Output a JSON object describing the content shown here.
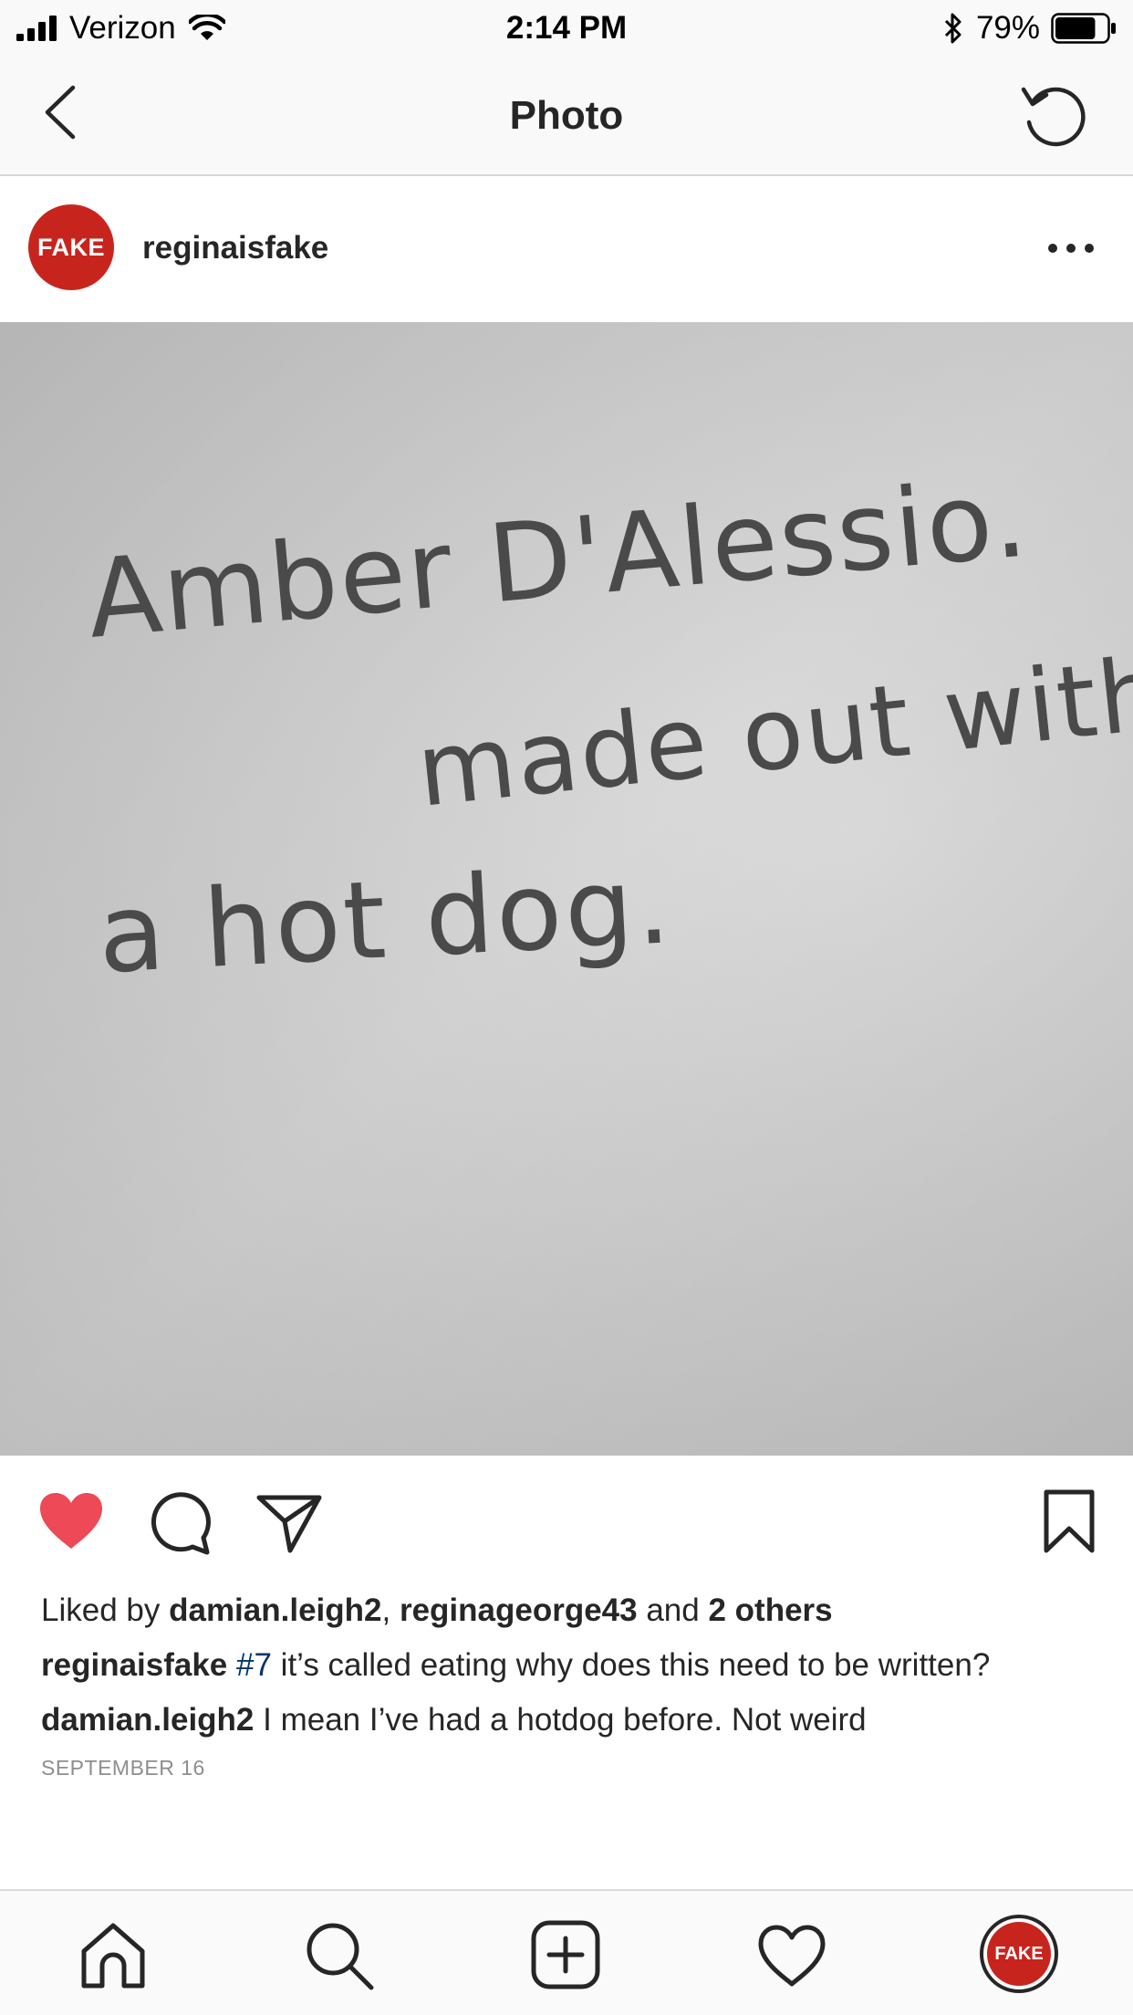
{
  "status_bar": {
    "carrier": "Verizon",
    "time": "2:14 PM",
    "battery_percent": "79%",
    "battery_level": 0.79,
    "icons": [
      "signal-icon",
      "wifi-icon",
      "bluetooth-icon",
      "battery-icon"
    ]
  },
  "nav": {
    "title": "Photo",
    "back_icon": "chevron-left-icon",
    "refresh_icon": "refresh-icon"
  },
  "post": {
    "avatar_text": "FAKE",
    "username": "reginaisfake",
    "photo_text_lines": [
      "Amber D'Alessio.",
      "made out with",
      "a hot dog."
    ],
    "liked": true,
    "likes": {
      "prefix": "Liked by ",
      "user1": "damian.leigh2",
      "sep": ", ",
      "user2": "reginageorge43",
      "and": " and ",
      "others": "2 others"
    },
    "caption": {
      "username": "reginaisfake",
      "hashtag": "#7",
      "text": " it’s called eating why does this need to be written?"
    },
    "comment": {
      "username": "damian.leigh2",
      "text": " I mean I’ve had a hotdog before. Not weird"
    },
    "date": "SEPTEMBER 16"
  },
  "tab_bar": {
    "items": [
      "home-icon",
      "search-icon",
      "new-post-icon",
      "activity-icon",
      "profile-avatar"
    ],
    "profile_text": "FAKE"
  },
  "colors": {
    "like_red": "#ed4956",
    "avatar_red": "#c8241e",
    "hashtag_blue": "#00376b",
    "date_gray": "#8e8e8e"
  }
}
